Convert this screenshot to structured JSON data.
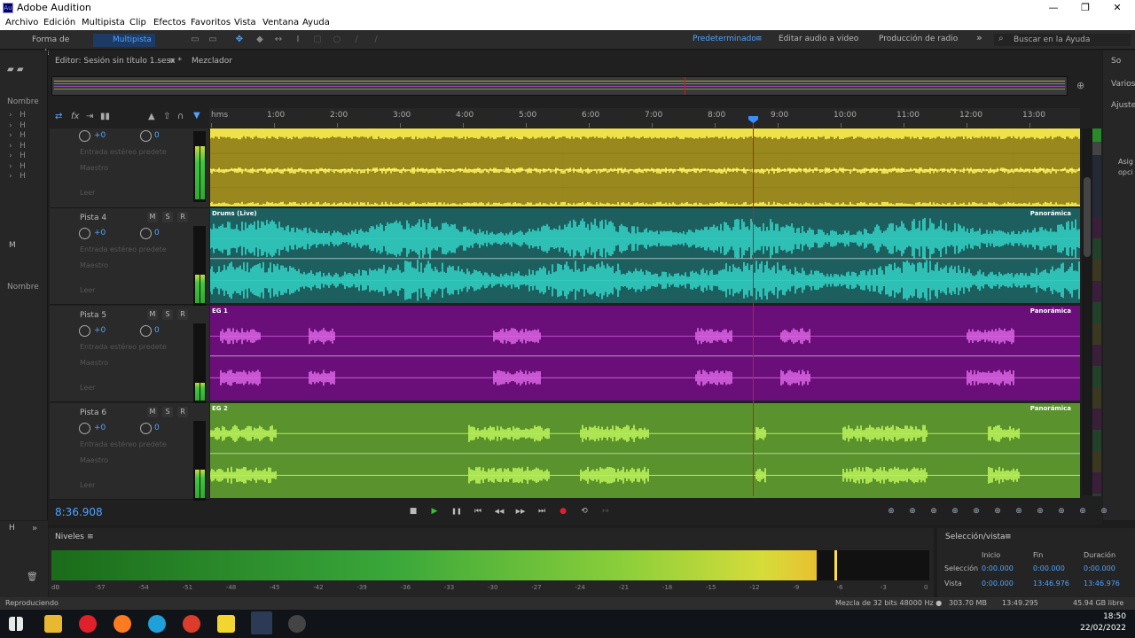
{
  "window": {
    "title": "Adobe Audition",
    "logo": "Au",
    "min": "—",
    "max": "❐",
    "close": "✕"
  },
  "menu": [
    "Archivo",
    "Edición",
    "Multipista",
    "Clip",
    "Efectos",
    "Favoritos",
    "Vista",
    "Ventana",
    "Ayuda"
  ],
  "toolbar": {
    "mode_waveform": "Forma de onda",
    "mode_multitrack": "Multipista",
    "workspaces": [
      "Predeterminado",
      "Editar audio a video",
      "Producción de radio"
    ],
    "more": "»",
    "search_placeholder": "Buscar en la Ayuda"
  },
  "left_panel": {
    "label_name1": "Nombre",
    "label_media": "M",
    "label_name2": "Nombre",
    "label_h": "H"
  },
  "right_panel": {
    "items": [
      "So",
      "Varios",
      "Ajuste",
      "Asig",
      "opci"
    ]
  },
  "editor": {
    "tab_label": "Editor: Sesión sin título 1.sesx *",
    "mixer_label": "Mezclador"
  },
  "ruler": {
    "labels": [
      "hms",
      "1:00",
      "2:00",
      "3:00",
      "4:00",
      "5:00",
      "6:00",
      "7:00",
      "8:00",
      "9:00",
      "10:00",
      "11:00",
      "12:00",
      "13:00"
    ]
  },
  "track_controls": {
    "volume": "+0",
    "pan": "0",
    "input": "Entrada estéreo predete",
    "output": "Maestro",
    "read": "Leer",
    "m": "M",
    "s": "S",
    "r": "R"
  },
  "tracks": [
    {
      "name": "",
      "clip_label": "",
      "pan_label": "",
      "color": "#efe14a",
      "wave": "#7a6a10"
    },
    {
      "name": "Pista 4",
      "clip_label": "Drums (Live)",
      "pan_label": "Panorámica",
      "color": "#1d5f5f",
      "wave": "#35e0d0"
    },
    {
      "name": "Pista 5",
      "clip_label": "EG 1",
      "pan_label": "Panorámica",
      "color": "#6a0f7a",
      "wave": "#e86ff0"
    },
    {
      "name": "Pista 6",
      "clip_label": "EG 2",
      "pan_label": "Panorámica",
      "color": "#5a922d",
      "wave": "#c8ff60"
    }
  ],
  "transport": {
    "timecode": "8:36.908",
    "stop": "■",
    "play": "▶",
    "pause": "❚❚",
    "to_start": "⏮",
    "rewind": "◀◀",
    "forward": "▶▶",
    "to_end": "⏭",
    "record": "●",
    "loop": "⟲",
    "skip": "↦"
  },
  "levels": {
    "title": "Niveles",
    "fill": 0.872,
    "ticks": [
      "dB",
      "-57",
      "-54",
      "-51",
      "-48",
      "-45",
      "-42",
      "-39",
      "-36",
      "-33",
      "-30",
      "-27",
      "-24",
      "-21",
      "-18",
      "-15",
      "-12",
      "-9",
      "-6",
      "-3",
      "0"
    ]
  },
  "selection_view": {
    "title": "Selección/vista",
    "col_start": "Inicio",
    "col_end": "Fin",
    "col_duration": "Duración",
    "row_selection": "Selección",
    "row_view": "Vista",
    "sel_start": "0:00.000",
    "sel_end": "0:00.000",
    "sel_duration": "0:00.000",
    "view_start": "0:00.000",
    "view_end": "13:46.976",
    "view_duration": "13:46.976"
  },
  "status": {
    "left": "Reproduciendo",
    "mix": "Mezcla de 32 bits 48000 Hz ●",
    "memory": "303.70 MB",
    "length": "13:49.295",
    "free": "45.94 GB libre"
  },
  "taskbar": {
    "time": "18:50",
    "date": "22/02/2022"
  },
  "colors": {
    "accent": "#4ea3ff",
    "playhead": "#c0202a",
    "record": "#e0202a",
    "play": "#2ec82e"
  }
}
